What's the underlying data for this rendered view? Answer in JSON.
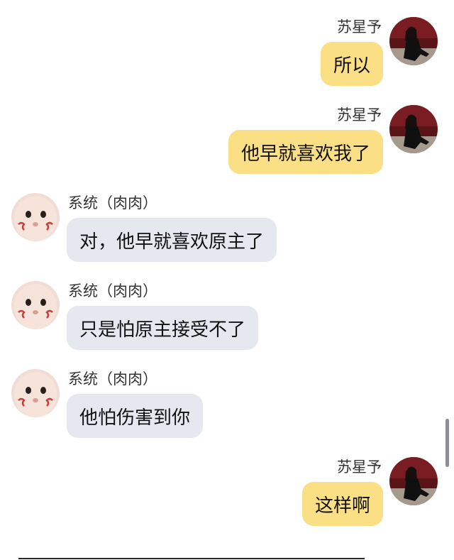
{
  "chat": {
    "messages": [
      {
        "sender": "苏星予",
        "text": "所以",
        "direction": "outgoing",
        "avatar": "woman-in-red-room-avatar"
      },
      {
        "sender": "苏星予",
        "text": "他早就喜欢我了",
        "direction": "outgoing",
        "avatar": "woman-in-red-room-avatar"
      },
      {
        "sender": "系统（肉肉）",
        "text": "对，他早就喜欢原主了",
        "direction": "incoming",
        "avatar": "baby-face-avatar"
      },
      {
        "sender": "系统（肉肉）",
        "text": "只是怕原主接受不了",
        "direction": "incoming",
        "avatar": "baby-face-avatar"
      },
      {
        "sender": "系统（肉肉）",
        "text": "他怕伤害到你",
        "direction": "incoming",
        "avatar": "baby-face-avatar"
      },
      {
        "sender": "苏星予",
        "text": "这样啊",
        "direction": "outgoing",
        "avatar": "woman-in-red-room-avatar"
      }
    ]
  },
  "colors": {
    "outgoing_bubble": "#fadf85",
    "incoming_bubble": "#e6e8ef",
    "background": "#ffffff"
  }
}
